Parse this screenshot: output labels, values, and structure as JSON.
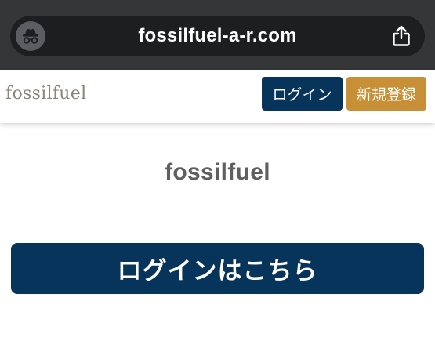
{
  "browser": {
    "url": "fossilfuel-a-r.com",
    "privacy_icon": "incognito-icon",
    "share_icon": "share-icon"
  },
  "header": {
    "logo": "fossilfuel",
    "login_label": "ログイン",
    "register_label": "新規登録"
  },
  "main": {
    "title": "fossilfuel",
    "login_button_label": "ログインはこちら"
  },
  "colors": {
    "browser_bar": "#343638",
    "url_pill": "#1d1e20",
    "primary": "#07345a",
    "accent": "#c78f36",
    "logo_text": "#8a8478",
    "title_text": "#5f5f5f"
  }
}
